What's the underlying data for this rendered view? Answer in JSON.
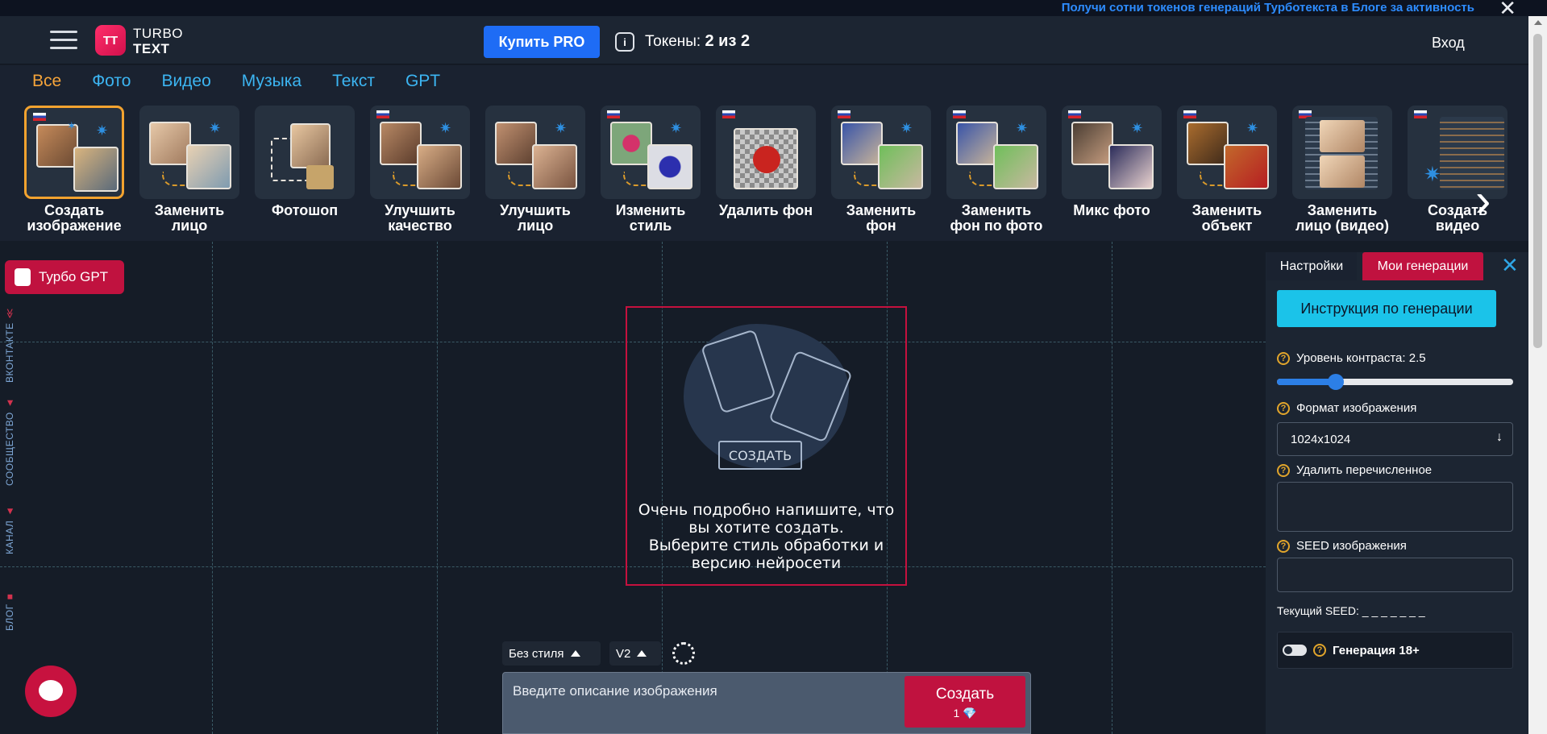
{
  "banner": {
    "message": "Получи сотни токенов генераций Турботекста в Блоге за активность",
    "close": "✕"
  },
  "header": {
    "logo_mark": "TT",
    "logo_line1": "TURBO",
    "logo_line2": "TEXT",
    "buy_pro": "Купить PRO",
    "tokens_label": "Токены:",
    "tokens_value": "2 из 2",
    "login": "Вход"
  },
  "categories": [
    {
      "label": "Все",
      "active": true
    },
    {
      "label": "Фото",
      "active": false
    },
    {
      "label": "Видео",
      "active": false
    },
    {
      "label": "Музыка",
      "active": false
    },
    {
      "label": "Текст",
      "active": false
    },
    {
      "label": "GPT",
      "active": false
    }
  ],
  "tools": [
    {
      "label": "Создать изображение",
      "active": true
    },
    {
      "label": "Заменить лицо",
      "active": false
    },
    {
      "label": "Фотошоп",
      "active": false
    },
    {
      "label": "Улучшить качество",
      "active": false
    },
    {
      "label": "Улучшить лицо",
      "active": false
    },
    {
      "label": "Изменить стиль",
      "active": false
    },
    {
      "label": "Удалить фон",
      "active": false
    },
    {
      "label": "Заменить фон",
      "active": false
    },
    {
      "label": "Заменить фон по фото",
      "active": false
    },
    {
      "label": "Микс фото",
      "active": false
    },
    {
      "label": "Заменить объект",
      "active": false
    },
    {
      "label": "Заменить лицо (видео)",
      "active": false
    },
    {
      "label": "Создать видео",
      "active": false
    }
  ],
  "left": {
    "turbo_gpt": "Турбо GPT",
    "side_links": [
      "ВКОНТАКТЕ",
      "СООБЩЕСТВО",
      "КАНАЛ",
      "БЛОГ"
    ]
  },
  "placeholder": {
    "illus_button": "СОЗДАТЬ",
    "line1": "Очень подробно напишите, что",
    "line2": "вы хотите создать.",
    "line3": "Выберите стиль обработки и",
    "line4": "версию нейросети"
  },
  "prompt": {
    "style_value": "Без стиля",
    "version_value": "V2",
    "placeholder": "Введите описание изображения",
    "create_label": "Создать",
    "create_cost": "1",
    "cost_icon": "💎"
  },
  "panel": {
    "tab_settings": "Настройки",
    "tab_generations": "Мои генерации",
    "instruction_button": "Инструкция по генерации",
    "contrast_label": "Уровень контраста:",
    "contrast_value": "2.5",
    "contrast_fraction": 0.25,
    "format_label": "Формат изображения",
    "format_value": "1024x1024",
    "negative_label": "Удалить перечисленное",
    "seed_label": "SEED изображения",
    "current_seed": "Текущий SEED: _ _ _ _ _ _ _",
    "nsfw_label": "Генерация 18+"
  }
}
